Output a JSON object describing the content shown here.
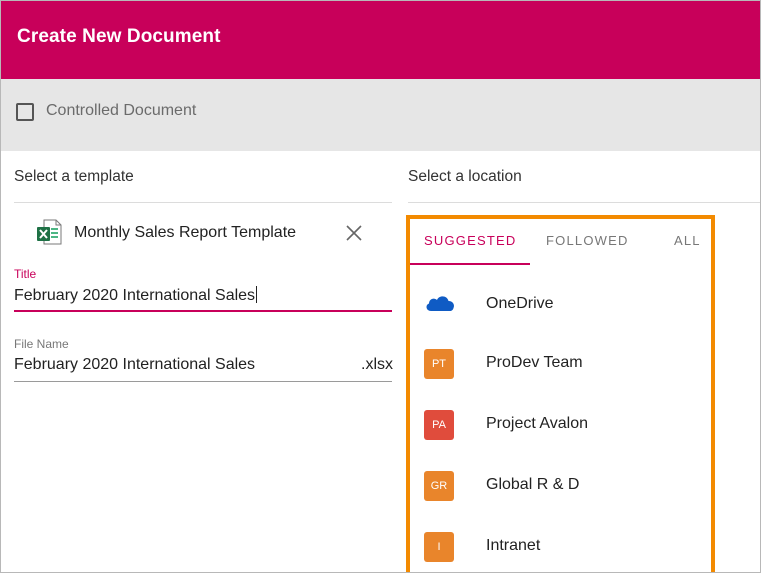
{
  "header": {
    "title": "Create New Document"
  },
  "controlled": {
    "label": "Controlled Document",
    "checked": false
  },
  "template_section": {
    "heading": "Select a template",
    "selected_template": "Monthly Sales Report Template",
    "template_icon": "excel-file-icon"
  },
  "title_field": {
    "label": "Title",
    "value": "February 2020 International Sales"
  },
  "filename_field": {
    "label": "File Name",
    "value": "February 2020 International Sales",
    "extension": ".xlsx"
  },
  "location_section": {
    "heading": "Select a location",
    "tabs": [
      {
        "label": "SUGGESTED",
        "active": true
      },
      {
        "label": "FOLLOWED",
        "active": false
      },
      {
        "label": "ALL",
        "active": false
      }
    ],
    "items": [
      {
        "name": "OneDrive",
        "icon": "onedrive-cloud-icon"
      },
      {
        "name": "ProDev Team",
        "initials": "PT",
        "color": "#e9852b"
      },
      {
        "name": "Project Avalon",
        "initials": "PA",
        "color": "#e04c3c"
      },
      {
        "name": "Global R & D",
        "initials": "GR",
        "color": "#e9852b"
      },
      {
        "name": "Intranet",
        "initials": "I",
        "color": "#e9852b"
      }
    ]
  },
  "colors": {
    "brand": "#c8005a",
    "highlight_border": "#f38a00",
    "onedrive_blue": "#0f5bc4",
    "excel_green": "#1e7145"
  }
}
